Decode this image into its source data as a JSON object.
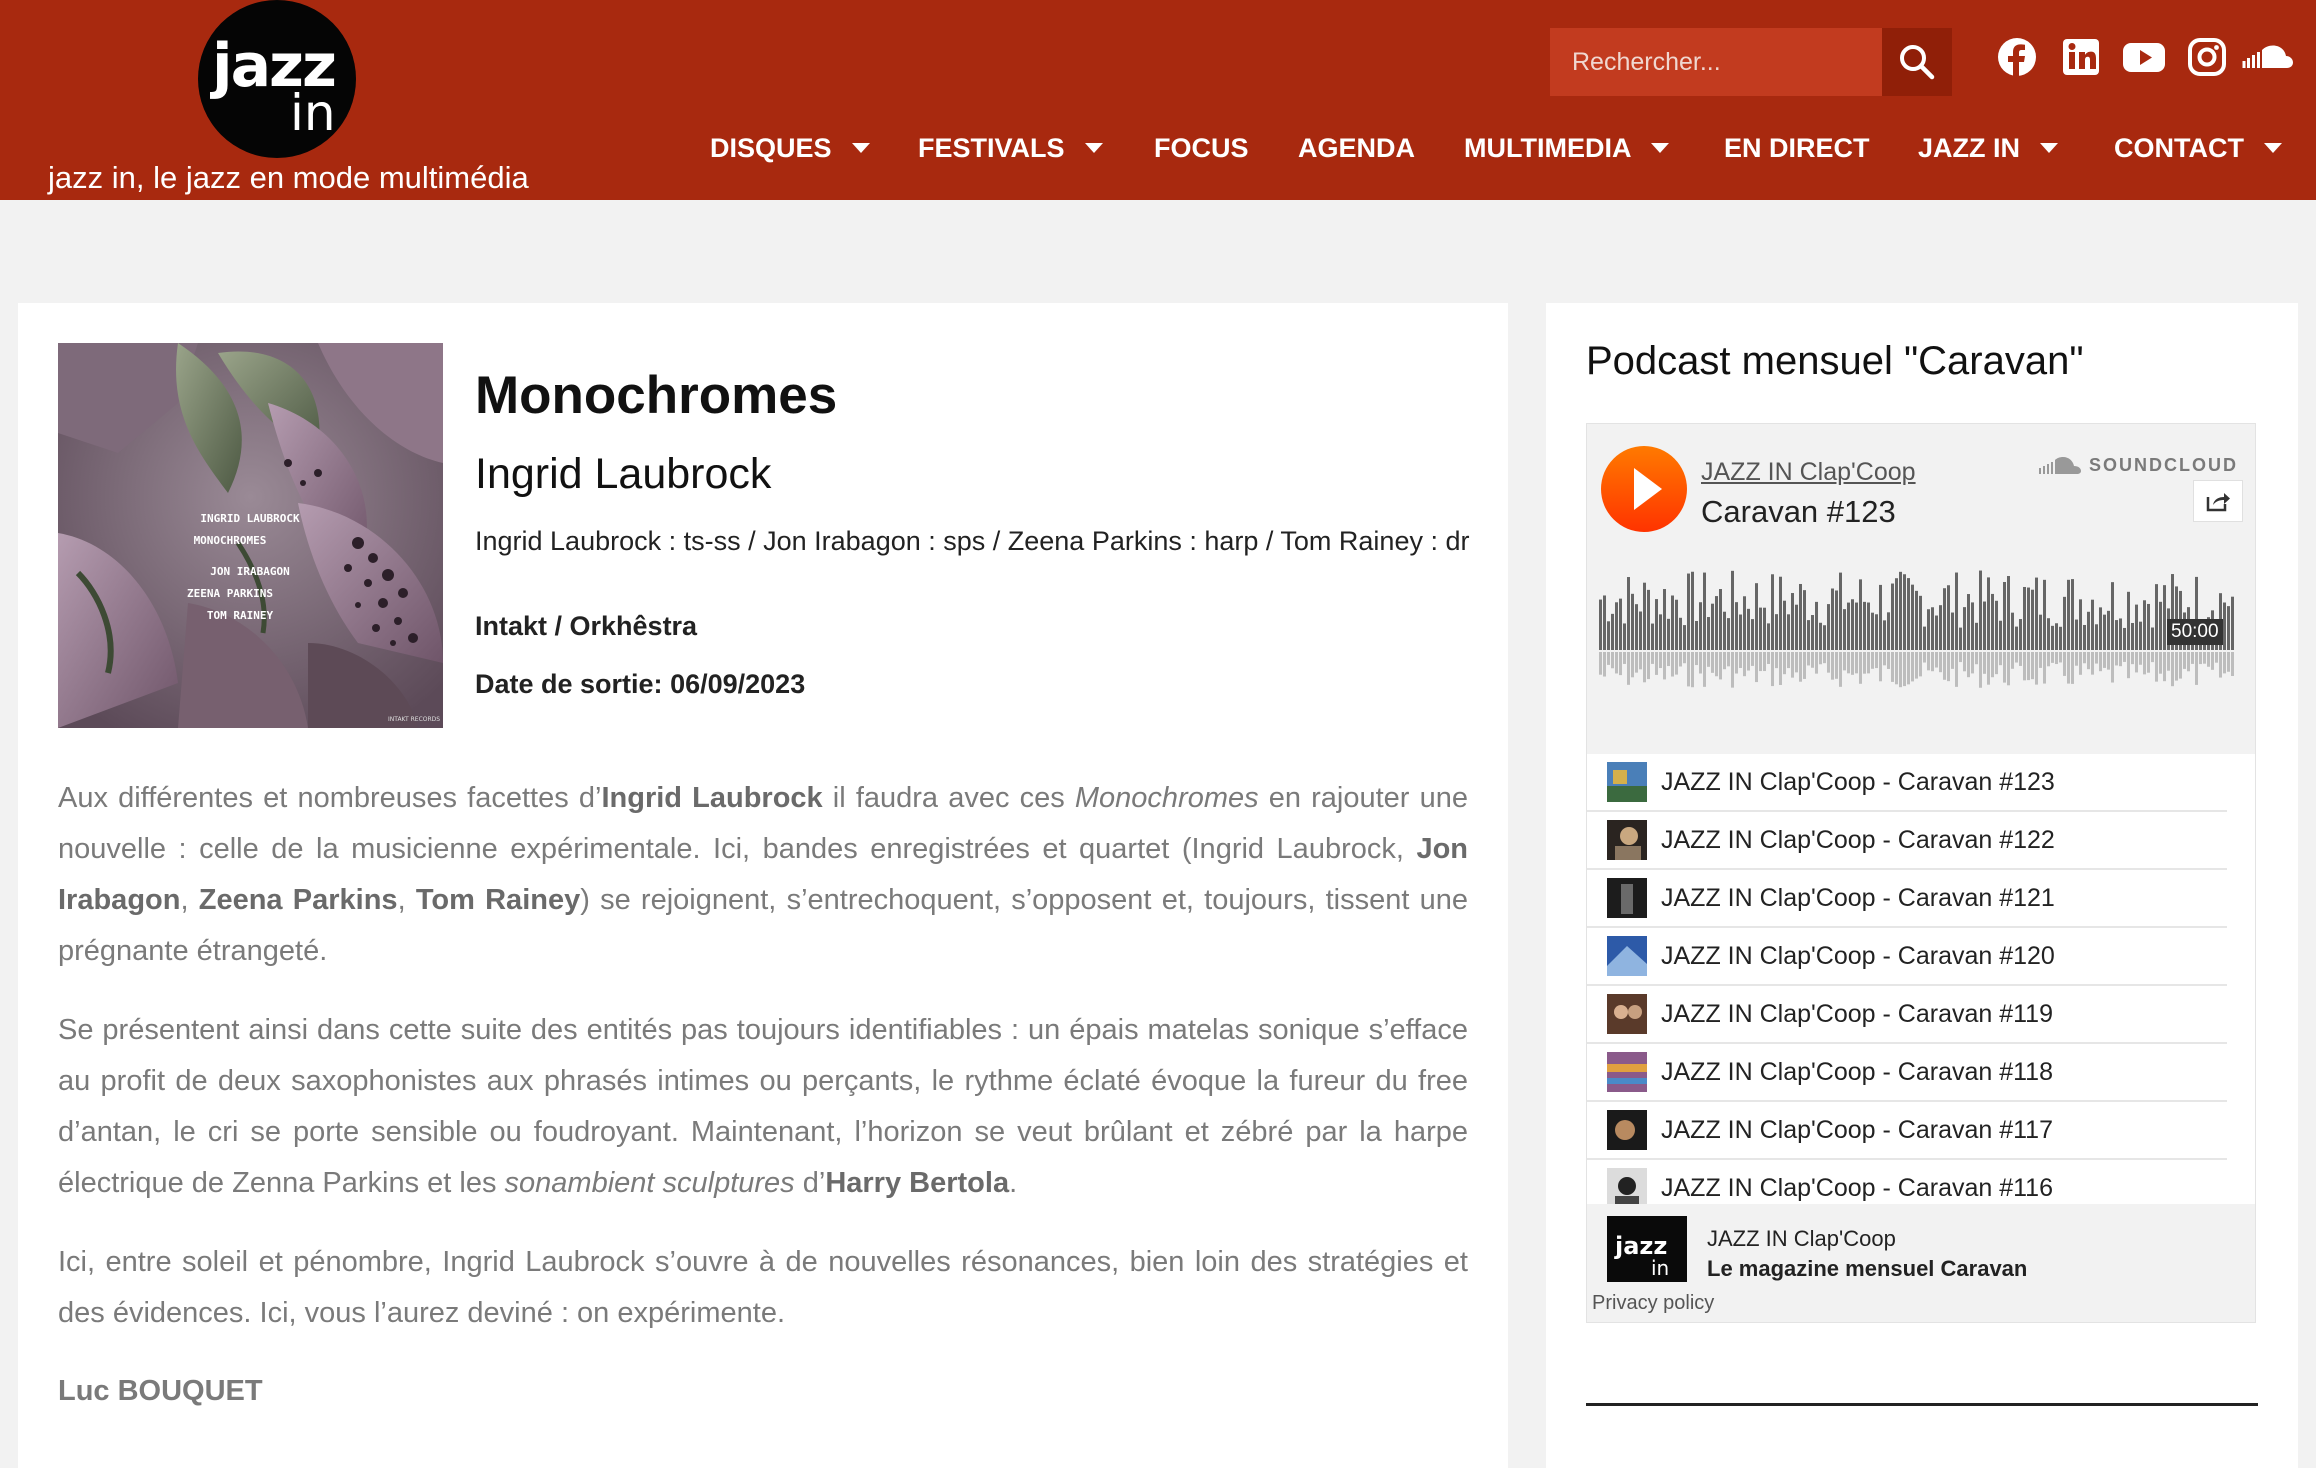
{
  "header": {
    "logo_word1": "jazz",
    "logo_word2": "in",
    "tagline": "jazz in, le jazz en mode multimédia",
    "search_placeholder": "Rechercher...",
    "nav": [
      {
        "label": "DISQUES",
        "has_dropdown": true
      },
      {
        "label": "FESTIVALS",
        "has_dropdown": true
      },
      {
        "label": "FOCUS",
        "has_dropdown": false
      },
      {
        "label": "AGENDA",
        "has_dropdown": false
      },
      {
        "label": "MULTIMEDIA",
        "has_dropdown": true
      },
      {
        "label": "EN DIRECT",
        "has_dropdown": false
      },
      {
        "label": "JAZZ IN",
        "has_dropdown": true
      },
      {
        "label": "CONTACT",
        "has_dropdown": true
      }
    ],
    "social_icons": [
      "facebook-icon",
      "linkedin-icon",
      "youtube-icon",
      "instagram-icon",
      "soundcloud-icon"
    ]
  },
  "album": {
    "title": "Monochromes",
    "artist": "Ingrid Laubrock",
    "personnel": "Ingrid Laubrock : ts-ss / Jon Irabagon : sps / Zeena Parkins : harp / Tom Rainey : dr",
    "label": "Intakt / Orkhêstra",
    "release_label": "Date de sortie:",
    "release_date": "06/09/2023",
    "cover_lines": [
      "INGRID LAUBROCK",
      "MONOCHROMES",
      "JON IRABAGON",
      "ZEENA PARKINS",
      "TOM RAINEY"
    ],
    "cover_imprint": "INTAKT RECORDS"
  },
  "review": {
    "p1": {
      "t1": "Aux différentes et nombreuses facettes d’",
      "b1": "Ingrid Laubrock",
      "t2": " il faudra avec ces ",
      "i1": "Monochromes",
      "t3": " en rajouter une nouvelle : celle de la musicienne expérimentale. Ici, bandes enregistrées et quartet (Ingrid Laubrock, ",
      "b2": "Jon Irabagon",
      "t4": ", ",
      "b3": "Zeena Parkins",
      "t5": ", ",
      "b4": "Tom Rainey",
      "t6": ") se rejoignent, s’entrechoquent, s’opposent et, toujours, tissent une prégnante étrangeté."
    },
    "p2": {
      "t1": "Se présentent ainsi dans cette suite des entités pas toujours identifiables : un épais matelas sonique s’efface au profit de deux saxophonistes aux phrasés intimes ou perçants, le rythme éclaté évoque la fureur du free d’antan, le cri se porte sensible ou foudroyant. Maintenant, l’horizon se veut brûlant et zébré par la harpe électrique de Zenna Parkins et les ",
      "i1": "sonambient sculptures",
      "t2": " d’",
      "b1": "Harry Bertola",
      "t3": "."
    },
    "p3": "Ici, entre soleil et pénombre, Ingrid Laubrock s’ouvre à de nouvelles résonances, bien loin des stratégies et des évidences. Ici, vous l’aurez deviné : on expérimente.",
    "author": "Luc BOUQUET"
  },
  "sidebar": {
    "title": "Podcast mensuel \"Caravan\"",
    "player": {
      "user": "JAZZ IN Clap'Coop",
      "track": "Caravan #123",
      "brand": "SOUNDCLOUD",
      "duration": "50:00",
      "tracks": [
        "JAZZ IN Clap'Coop - Caravan #123",
        "JAZZ IN Clap'Coop - Caravan #122",
        "JAZZ IN Clap'Coop - Caravan #121",
        "JAZZ IN Clap'Coop - Caravan #120",
        "JAZZ IN Clap'Coop - Caravan #119",
        "JAZZ IN Clap'Coop - Caravan #118",
        "JAZZ IN Clap'Coop - Caravan #117",
        "JAZZ IN Clap'Coop - Caravan #116"
      ],
      "footer_logo_word1": "jazz",
      "footer_logo_word2": "in",
      "footer_name": "JAZZ IN Clap'Coop",
      "footer_desc": "Le magazine mensuel Caravan",
      "privacy": "Privacy policy"
    }
  },
  "colors": {
    "header_bg": "#a8290f",
    "search_bg": "#c23b1f",
    "search_btn": "#901f08",
    "soundcloud_orange": "#ff5500"
  }
}
